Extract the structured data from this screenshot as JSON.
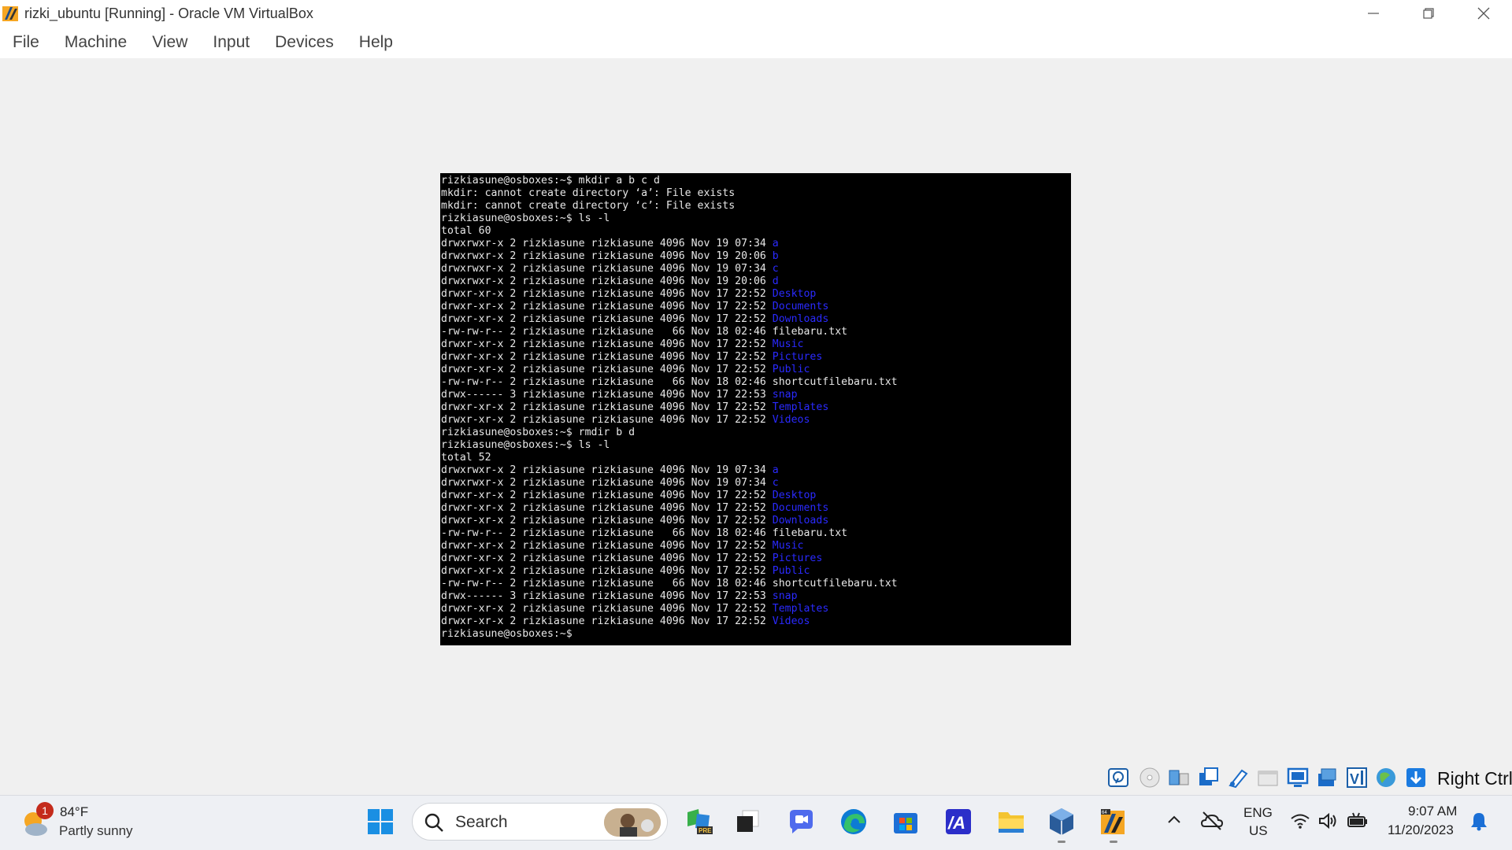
{
  "window": {
    "title": "rizki_ubuntu [Running] - Oracle VM VirtualBox",
    "minimize_glyph": "—",
    "maximize_glyph": "❐",
    "close_glyph": "✕"
  },
  "menu": {
    "items": [
      {
        "label": "File"
      },
      {
        "label": "Machine"
      },
      {
        "label": "View"
      },
      {
        "label": "Input"
      },
      {
        "label": "Devices"
      },
      {
        "label": "Help"
      }
    ]
  },
  "terminal": {
    "lines": [
      {
        "text": "rizkiasune@osboxes:~$ mkdir a b c d"
      },
      {
        "text": "mkdir: cannot create directory ‘a’: File exists"
      },
      {
        "text": "mkdir: cannot create directory ‘c’: File exists"
      },
      {
        "text": "rizkiasune@osboxes:~$ ls -l"
      },
      {
        "text": "total 60"
      },
      {
        "text": "drwxrwxr-x 2 rizkiasune rizkiasune 4096 Nov 19 07:34 ",
        "dir": "a"
      },
      {
        "text": "drwxrwxr-x 2 rizkiasune rizkiasune 4096 Nov 19 20:06 ",
        "dir": "b"
      },
      {
        "text": "drwxrwxr-x 2 rizkiasune rizkiasune 4096 Nov 19 07:34 ",
        "dir": "c"
      },
      {
        "text": "drwxrwxr-x 2 rizkiasune rizkiasune 4096 Nov 19 20:06 ",
        "dir": "d"
      },
      {
        "text": "drwxr-xr-x 2 rizkiasune rizkiasune 4096 Nov 17 22:52 ",
        "dir": "Desktop"
      },
      {
        "text": "drwxr-xr-x 2 rizkiasune rizkiasune 4096 Nov 17 22:52 ",
        "dir": "Documents"
      },
      {
        "text": "drwxr-xr-x 2 rizkiasune rizkiasune 4096 Nov 17 22:52 ",
        "dir": "Downloads"
      },
      {
        "text": "-rw-rw-r-- 2 rizkiasune rizkiasune   66 Nov 18 02:46 filebaru.txt"
      },
      {
        "text": "drwxr-xr-x 2 rizkiasune rizkiasune 4096 Nov 17 22:52 ",
        "dir": "Music"
      },
      {
        "text": "drwxr-xr-x 2 rizkiasune rizkiasune 4096 Nov 17 22:52 ",
        "dir": "Pictures"
      },
      {
        "text": "drwxr-xr-x 2 rizkiasune rizkiasune 4096 Nov 17 22:52 ",
        "dir": "Public"
      },
      {
        "text": "-rw-rw-r-- 2 rizkiasune rizkiasune   66 Nov 18 02:46 shortcutfilebaru.txt"
      },
      {
        "text": "drwx------ 3 rizkiasune rizkiasune 4096 Nov 17 22:53 ",
        "dir": "snap"
      },
      {
        "text": "drwxr-xr-x 2 rizkiasune rizkiasune 4096 Nov 17 22:52 ",
        "dir": "Templates"
      },
      {
        "text": "drwxr-xr-x 2 rizkiasune rizkiasune 4096 Nov 17 22:52 ",
        "dir": "Videos"
      },
      {
        "text": "rizkiasune@osboxes:~$ rmdir b d"
      },
      {
        "text": "rizkiasune@osboxes:~$ ls -l"
      },
      {
        "text": "total 52"
      },
      {
        "text": "drwxrwxr-x 2 rizkiasune rizkiasune 4096 Nov 19 07:34 ",
        "dir": "a"
      },
      {
        "text": "drwxrwxr-x 2 rizkiasune rizkiasune 4096 Nov 19 07:34 ",
        "dir": "c"
      },
      {
        "text": "drwxr-xr-x 2 rizkiasune rizkiasune 4096 Nov 17 22:52 ",
        "dir": "Desktop"
      },
      {
        "text": "drwxr-xr-x 2 rizkiasune rizkiasune 4096 Nov 17 22:52 ",
        "dir": "Documents"
      },
      {
        "text": "drwxr-xr-x 2 rizkiasune rizkiasune 4096 Nov 17 22:52 ",
        "dir": "Downloads"
      },
      {
        "text": "-rw-rw-r-- 2 rizkiasune rizkiasune   66 Nov 18 02:46 filebaru.txt"
      },
      {
        "text": "drwxr-xr-x 2 rizkiasune rizkiasune 4096 Nov 17 22:52 ",
        "dir": "Music"
      },
      {
        "text": "drwxr-xr-x 2 rizkiasune rizkiasune 4096 Nov 17 22:52 ",
        "dir": "Pictures"
      },
      {
        "text": "drwxr-xr-x 2 rizkiasune rizkiasune 4096 Nov 17 22:52 ",
        "dir": "Public"
      },
      {
        "text": "-rw-rw-r-- 2 rizkiasune rizkiasune   66 Nov 18 02:46 shortcutfilebaru.txt"
      },
      {
        "text": "drwx------ 3 rizkiasune rizkiasune 4096 Nov 17 22:53 ",
        "dir": "snap"
      },
      {
        "text": "drwxr-xr-x 2 rizkiasune rizkiasune 4096 Nov 17 22:52 ",
        "dir": "Templates"
      },
      {
        "text": "drwxr-xr-x 2 rizkiasune rizkiasune 4096 Nov 17 22:52 ",
        "dir": "Videos"
      },
      {
        "text": "rizkiasune@osboxes:~$"
      }
    ],
    "colors": {
      "background": "#000000",
      "foreground": "#e8e8e8",
      "directory": "#2a2aff"
    }
  },
  "status_bar": {
    "icons": [
      "hard-disk-icon",
      "optical-drive-icon",
      "audio-icon",
      "network-icon",
      "usb-icon",
      "shared-folders-icon",
      "display-icon",
      "recording-icon",
      "cpu-icon",
      "mouse-integration-icon",
      "keyboard-capture-icon"
    ],
    "host_key": "Right Ctrl"
  },
  "taskbar": {
    "weather": {
      "temp": "84°F",
      "condition": "Partly sunny",
      "badge": "1"
    },
    "search_placeholder": "Search",
    "apps": [
      "start-icon",
      "search",
      "copilot-pre-icon",
      "task-view-icon",
      "teams-chat-icon",
      "edge-icon",
      "store-icon",
      "ai-app-icon",
      "file-explorer-icon",
      "virtualbox-icon",
      "virtualbox-vm-icon"
    ],
    "tray": {
      "lang_line1": "ENG",
      "lang_line2": "US",
      "time": "9:07 AM",
      "date": "11/20/2023"
    }
  }
}
